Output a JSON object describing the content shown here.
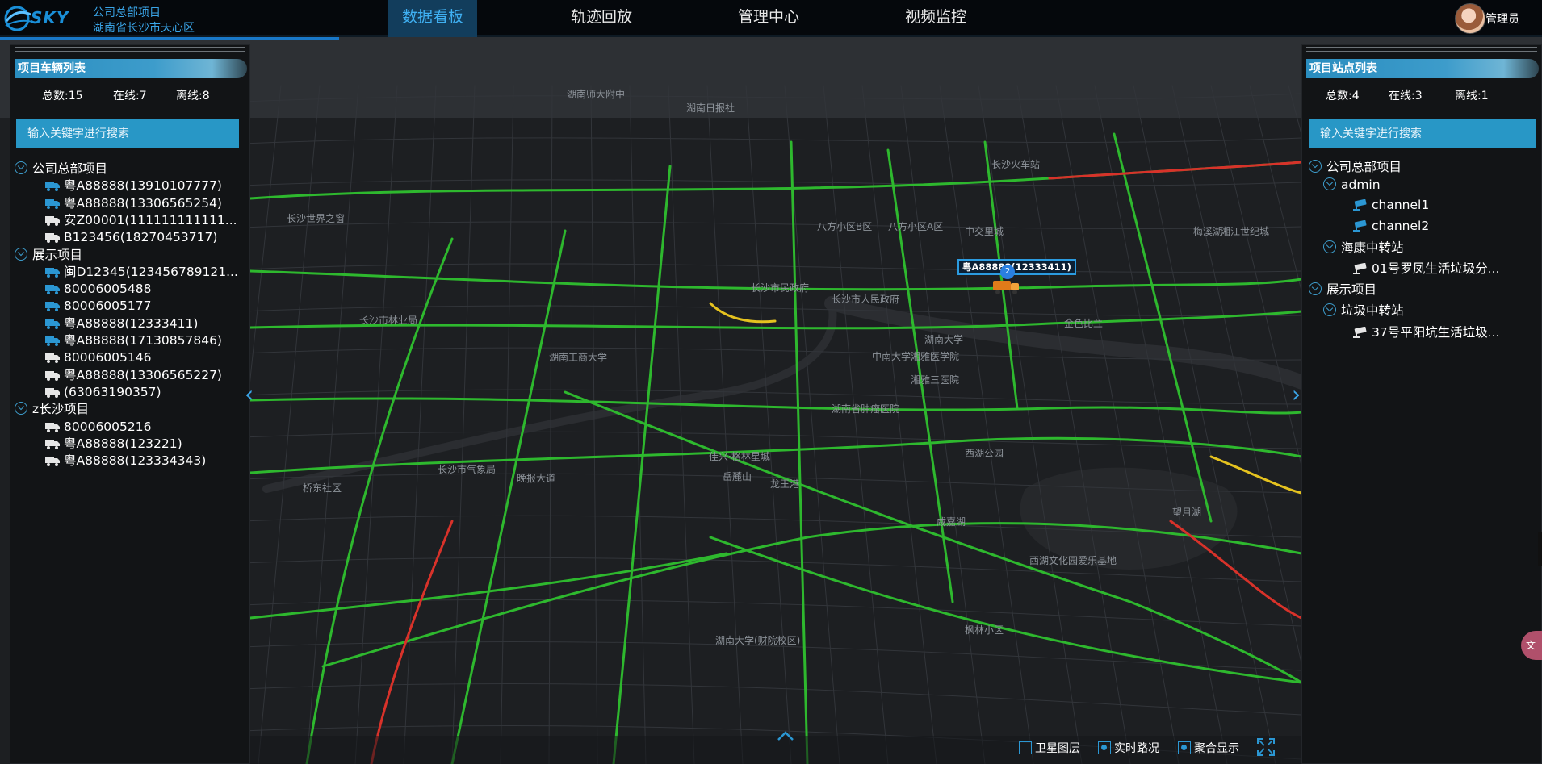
{
  "header": {
    "logo_text": "SKY",
    "project_name": "公司总部项目",
    "project_address": "湖南省长沙市天心区",
    "nav": [
      {
        "label": "数据看板",
        "active": true
      },
      {
        "label": "轨迹回放",
        "active": false
      },
      {
        "label": "管理中心",
        "active": false
      },
      {
        "label": "视频监控",
        "active": false
      }
    ],
    "user_label": "管理员"
  },
  "left_panel": {
    "title": "项目车辆列表",
    "stats": {
      "total": "总数:15",
      "online": "在线:7",
      "offline": "离线:8"
    },
    "search_placeholder": "输入关键字进行搜索",
    "groups": [
      {
        "name": "公司总部项目",
        "vehicles": [
          {
            "label": "粤A88888(13910107777)",
            "online": true
          },
          {
            "label": "粤A88888(13306565254)",
            "online": true
          },
          {
            "label": "安Z00001(111111111111...",
            "online": false
          },
          {
            "label": "B123456(18270453717)",
            "online": false
          }
        ]
      },
      {
        "name": "展示项目",
        "vehicles": [
          {
            "label": "闽D12345(123456789121...",
            "online": true
          },
          {
            "label": "80006005488",
            "online": true
          },
          {
            "label": "80006005177",
            "online": true
          },
          {
            "label": "粤A88888(12333411)",
            "online": true
          },
          {
            "label": "粤A88888(17130857846)",
            "online": true
          },
          {
            "label": "80006005146",
            "online": false
          },
          {
            "label": "粤A88888(13306565227)",
            "online": false
          },
          {
            "label": "(63063190357)",
            "online": false
          }
        ]
      },
      {
        "name": "z长沙项目",
        "vehicles": [
          {
            "label": "80006005216",
            "online": false
          },
          {
            "label": "粤A88888(123221)",
            "online": false
          },
          {
            "label": "粤A88888(123334343)",
            "online": false
          }
        ]
      }
    ]
  },
  "right_panel": {
    "title": "项目站点列表",
    "stats": {
      "total": "总数:4",
      "online": "在线:3",
      "offline": "离线:1"
    },
    "search_placeholder": "输入关键字进行搜索",
    "tree": [
      {
        "label": "公司总部项目"
      },
      {
        "label": "admin"
      },
      {
        "label": "channel1"
      },
      {
        "label": "channel2"
      },
      {
        "label": "海康中转站"
      },
      {
        "label": "01号罗凤生活垃圾分..."
      },
      {
        "label": "展示项目"
      },
      {
        "label": "垃圾中转站"
      },
      {
        "label": "37号平阳坑生活垃圾..."
      }
    ]
  },
  "map": {
    "marker_label": "粤A88888(12333411)",
    "marker_count": "2",
    "labels": [
      "湖南日报社",
      "长沙火车站",
      "八方小区B区",
      "八方小区A区",
      "中交里城",
      "长沙市民政府",
      "湖南大学",
      "长沙市人民政府",
      "湖南省肿瘤医院",
      "中南大学湘雅医学院",
      "佳兴·格林星城",
      "龙王港",
      "西湖公园",
      "西湖文化园爱乐基地",
      "咸嘉湖",
      "湖南大学(财院校区)",
      "岳麓山",
      "长沙市气象局",
      "望月湖",
      "湖南师大附中",
      "枫林小区",
      "长沙世界之窗",
      "长沙市林业局",
      "湖南工商大学",
      "湘雅三医院",
      "桥东社区",
      "晚报大道",
      "梅溪湖",
      "湘江世纪城",
      "金色比兰"
    ],
    "controls": {
      "satellite": "卫星图层",
      "traffic": "实时路况",
      "cluster": "聚合显示"
    },
    "right_tab": "文"
  },
  "colors": {
    "accent": "#2897c6",
    "nav_active_bg": "#123d5c",
    "road_green": "#2eb82e",
    "road_red": "#d8322a",
    "road_yellow": "#e5c21f"
  }
}
